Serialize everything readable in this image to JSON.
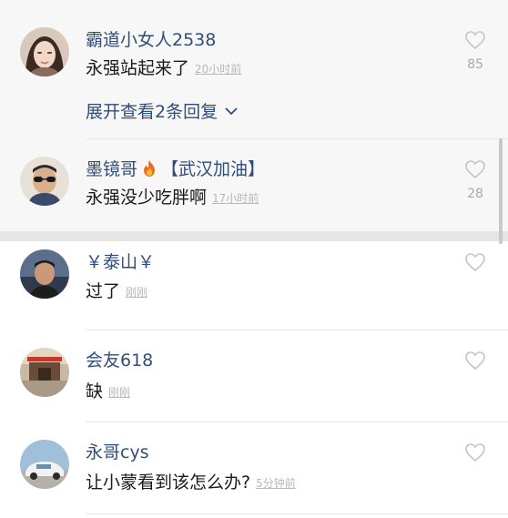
{
  "comments": [
    {
      "username": "霸道小女人2538",
      "content": "永强站起来了",
      "time": "20小时前",
      "likes": "85",
      "expand_label": "展开查看2条回复"
    },
    {
      "username": "墨镜哥",
      "badge": "【武汉加油】",
      "content": "永强没少吃胖啊",
      "time": "17小时前",
      "likes": "28"
    },
    {
      "username": "￥泰山￥",
      "content": "过了",
      "time": "刚刚"
    },
    {
      "username": "会友618",
      "content": "缺",
      "time": "刚刚"
    },
    {
      "username": "永哥cys",
      "content": "让小蒙看到该怎么办?",
      "time": "5分钟前"
    }
  ],
  "colors": {
    "username": "#2f4e7a",
    "text": "#1a1a1a",
    "meta": "#b8b8b8",
    "highlight_bg": "#f7f7f7"
  },
  "icons": [
    "heart-outline-icon",
    "fire-emoji-icon",
    "chevron-down-icon"
  ]
}
